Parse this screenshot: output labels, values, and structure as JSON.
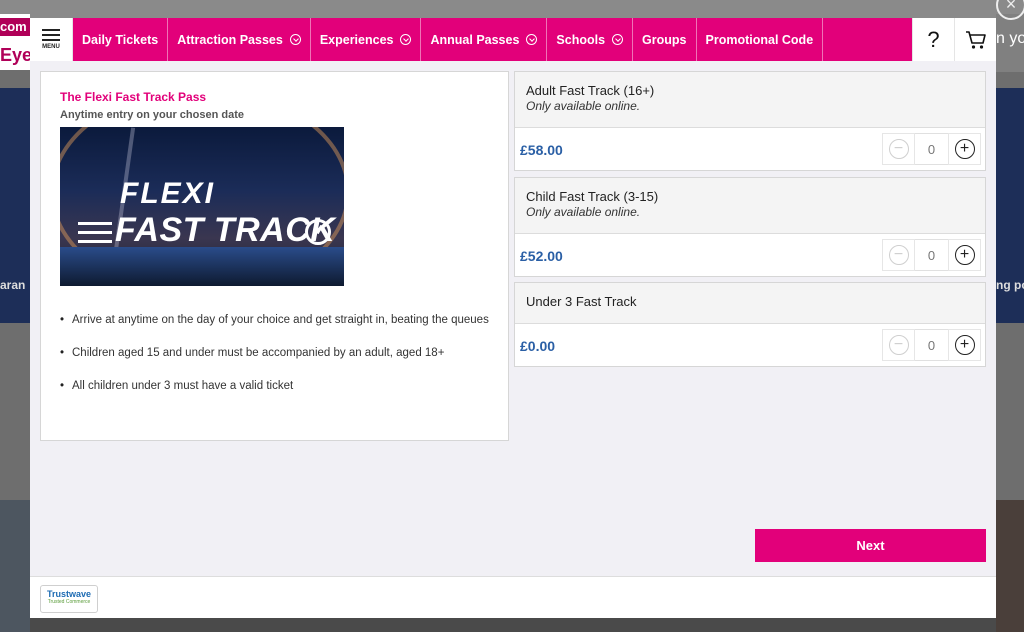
{
  "background": {
    "brand_top": "com",
    "brand_bottom": "Eye",
    "left_band_text": "aran",
    "right_top_text": "n yo",
    "right_band_text": "ng po",
    "close_glyph": "×"
  },
  "nav": {
    "menu_label": "MENU",
    "tabs": [
      {
        "label": "Daily Tickets",
        "dropdown": false
      },
      {
        "label": "Attraction Passes",
        "dropdown": true
      },
      {
        "label": "Experiences",
        "dropdown": true
      },
      {
        "label": "Annual Passes",
        "dropdown": true
      },
      {
        "label": "Schools",
        "dropdown": true
      },
      {
        "label": "Groups",
        "dropdown": false
      },
      {
        "label": "Promotional Code",
        "dropdown": false
      }
    ],
    "help_glyph": "?",
    "accent_color": "#e2007a"
  },
  "info": {
    "title": "The Flexi Fast Track Pass",
    "subtitle": "Anytime entry on your chosen date",
    "hero_line1": "FLEXI",
    "hero_line2": "FAST TRACK",
    "bullets": [
      "Arrive at anytime on the day of your choice and get straight in, beating the queues",
      "Children aged 15 and under must be accompanied by an adult, aged 18+",
      "All children under 3 must have a valid ticket"
    ]
  },
  "tickets": [
    {
      "name": "Adult Fast Track (16+)",
      "note": "Only available online.",
      "price": "£58.00",
      "qty": "0"
    },
    {
      "name": "Child Fast Track (3-15)",
      "note": "Only available online.",
      "price": "£52.00",
      "qty": "0"
    },
    {
      "name": "Under 3 Fast Track",
      "note": "",
      "price": "£0.00",
      "qty": "0"
    }
  ],
  "stepper": {
    "minus": "−",
    "plus": "+"
  },
  "actions": {
    "next_label": "Next"
  },
  "footer": {
    "trust_name": "Trustwave",
    "trust_sub": "Trusted Commerce"
  }
}
